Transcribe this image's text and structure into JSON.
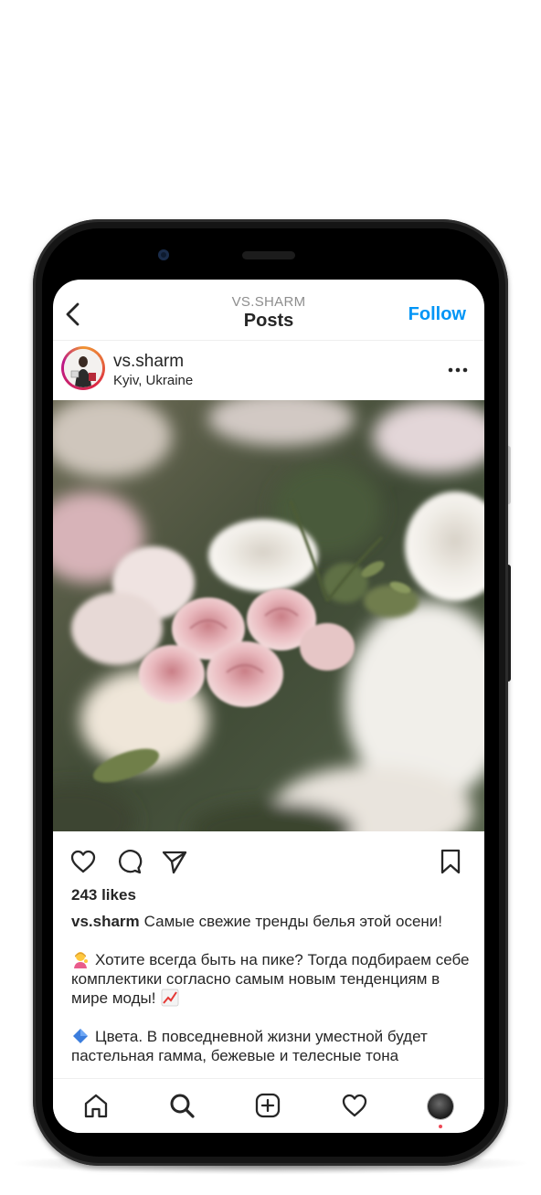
{
  "header": {
    "account_label": "VS.SHARM",
    "title": "Posts",
    "follow_label": "Follow"
  },
  "post": {
    "username": "vs.sharm",
    "location": "Kyiv, Ukraine",
    "likes_text": "243 likes",
    "caption": {
      "username": "vs.sharm",
      "line1": "Самые свежие тренды белья этой осени!",
      "line2": "Хотите всегда быть на пике? Тогда подбираем себе комплектики согласно самым новым тенденциям в мире моды!",
      "line3": "Цвета. В повседневной жизни уместной будет пастельная гамма, бежевые и телесные тона"
    }
  },
  "icons": {
    "back": "chevron-left-icon",
    "more": "more-horizontal-icon",
    "like": "heart-icon",
    "comment": "comment-icon",
    "share": "send-icon",
    "save": "bookmark-icon",
    "nav_home": "home-icon",
    "nav_search": "search-icon",
    "nav_add": "plus-square-icon",
    "nav_activity": "heart-icon",
    "nav_profile": "profile-avatar"
  },
  "colors": {
    "accent": "#0095f6",
    "text": "#262626",
    "secondary": "#8e8e8e",
    "notification": "#ed4956"
  }
}
